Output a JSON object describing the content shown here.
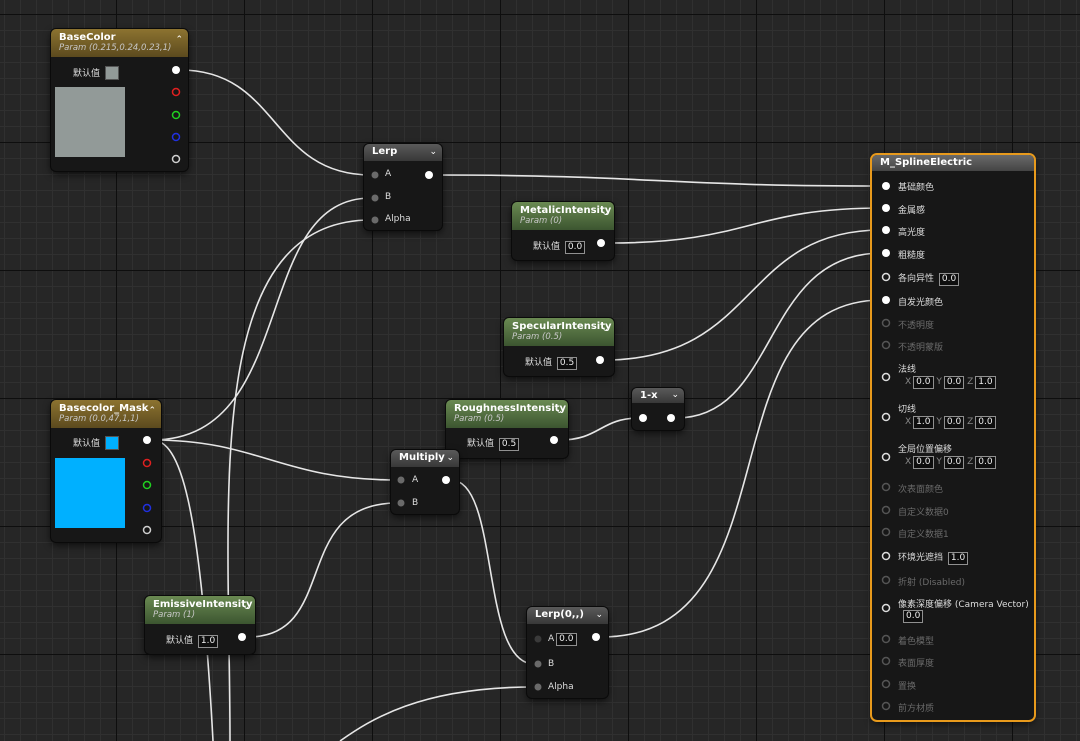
{
  "nodes": {
    "basecolor": {
      "title": "BaseColor",
      "subtitle": "Param (0.215,0.24,0.23,1)",
      "default_label": "默认值",
      "color": "#929a98"
    },
    "basecolor_mask": {
      "title": "Basecolor_Mask",
      "subtitle": "Param (0.0,47,1,1)",
      "default_label": "默认值",
      "color": "#00b0ff"
    },
    "lerp": {
      "title": "Lerp",
      "pins": [
        "A",
        "B",
        "Alpha"
      ]
    },
    "metallic": {
      "title": "MetalicIntensity",
      "subtitle": "Param (0)",
      "default_label": "默认值",
      "value": "0.0"
    },
    "specular": {
      "title": "SpecularIntensity",
      "subtitle": "Param (0.5)",
      "default_label": "默认值",
      "value": "0.5"
    },
    "roughness": {
      "title": "RoughnessIntensity",
      "subtitle": "Param (0.5)",
      "default_label": "默认值",
      "value": "0.5"
    },
    "oneminus": {
      "title": "1-x"
    },
    "multiply": {
      "title": "Multiply",
      "pins": [
        "A",
        "B"
      ]
    },
    "emissive": {
      "title": "EmissiveIntensity",
      "subtitle": "Param (1)",
      "default_label": "默认值",
      "value": "1.0"
    },
    "lerp2": {
      "title": "Lerp(0,,)",
      "pin_a": "A",
      "pin_a_value": "0.0",
      "pin_b": "B",
      "pin_alpha": "Alpha"
    }
  },
  "material": {
    "title": "M_SplineElectric",
    "base_color": "基础颜色",
    "metallic": "金属感",
    "specular": "高光度",
    "roughness": "粗糙度",
    "anisotropy": "各向异性",
    "anisotropy_value": "0.0",
    "emissive": "自发光颜色",
    "opacity": "不透明度",
    "opacity_mask": "不透明蒙版",
    "normal": "法线",
    "normal_x": "0.0",
    "normal_y": "0.0",
    "normal_z": "1.0",
    "tangent": "切线",
    "tangent_x": "1.0",
    "tangent_y": "0.0",
    "tangent_z": "0.0",
    "wpo": "全局位置偏移",
    "wpo_x": "0.0",
    "wpo_y": "0.0",
    "wpo_z": "0.0",
    "subsurface": "次表面颜色",
    "custom0": "自定义数据0",
    "custom1": "自定义数据1",
    "ao": "环境光遮挡",
    "ao_value": "1.0",
    "refraction": "折射 (Disabled)",
    "pdo": "像素深度偏移 (Camera Vector)",
    "pdo_value": "0.0",
    "shading_model": "着色模型",
    "surface_thickness": "表面厚度",
    "displacement": "置换",
    "front_material": "前方材质"
  },
  "axes": {
    "x": "X",
    "y": "Y",
    "z": "Z"
  },
  "colors": {
    "accent": "#e89a1c",
    "wire": "#e6e6e6",
    "red": "#e02020",
    "green": "#20d020",
    "blue": "#2030e0"
  }
}
